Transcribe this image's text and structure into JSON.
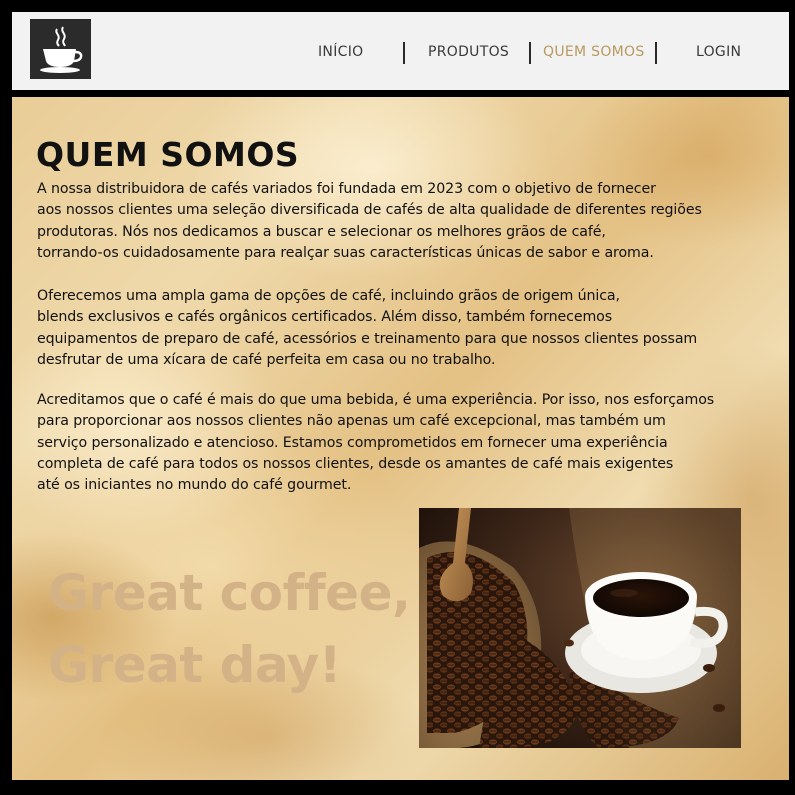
{
  "header": {
    "logo": "coffee-cup-logo",
    "nav": [
      {
        "label": "INÍCIO",
        "active": false
      },
      {
        "label": "PRODUTOS",
        "active": false
      },
      {
        "label": "QUEM SOMOS",
        "active": true
      },
      {
        "label": "LOGIN",
        "active": false
      }
    ],
    "active_color": "#b89a5e"
  },
  "main": {
    "title": "QUEM SOMOS",
    "paragraphs": [
      {
        "lines": [
          "A nossa distribuidora de cafés variados foi fundada em 2023 com o objetivo de fornecer",
          "aos nossos clientes uma seleção diversificada de cafés de alta qualidade de diferentes regiões",
          "produtoras. Nós nos dedicamos a buscar e selecionar os melhores grãos de café,",
          "torrando-os cuidadosamente para realçar suas características únicas de sabor e aroma."
        ]
      },
      {
        "lines": [
          "Oferecemos uma ampla gama de opções de café, incluindo grãos de origem única,",
          "blends exclusivos e cafés orgânicos certificados. Além disso, também fornecemos",
          "equipamentos de preparo de café, acessórios e treinamento para que nossos clientes possam",
          "desfrutar de uma xícara de café perfeita em casa ou no trabalho."
        ]
      },
      {
        "lines": [
          "Acreditamos que o café é mais do que uma bebida, é uma experiência. Por isso, nos esforçamos",
          "para proporcionar aos nossos clientes não apenas um café excepcional, mas também um",
          "serviço personalizado e atencioso. Estamos comprometidos em fornecer uma experiência",
          "completa de café para todos os nossos clientes, desde os amantes de café mais exigentes",
          "até os iniciantes no mundo do café gourmet."
        ]
      }
    ],
    "slogan": [
      "Great coffee,",
      "Great day!"
    ],
    "slogan_color": "#d4b287",
    "photo": "coffee-cup-with-beans-photo"
  }
}
